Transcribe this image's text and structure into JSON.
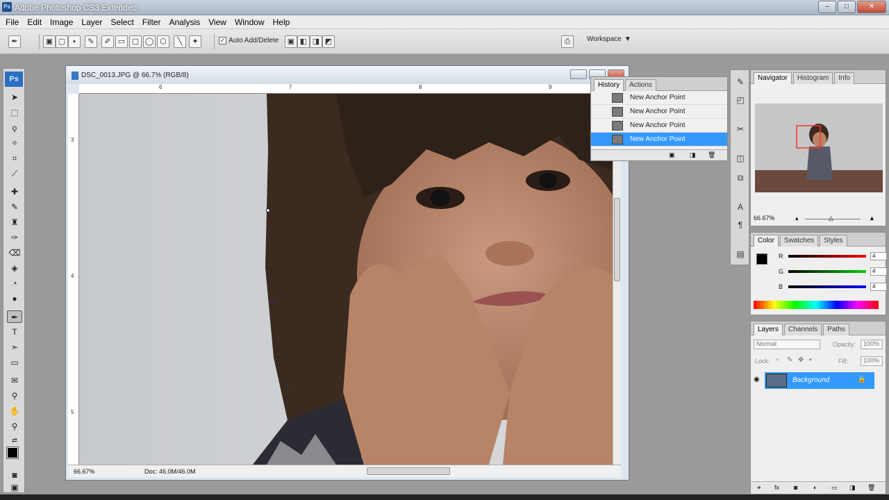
{
  "app": {
    "title": "Adobe Photoshop CS3 Extended"
  },
  "menu": [
    "File",
    "Edit",
    "Image",
    "Layer",
    "Select",
    "Filter",
    "Analysis",
    "View",
    "Window",
    "Help"
  ],
  "options_bar": {
    "auto_add_delete_label": "Auto Add/Delete",
    "auto_add_delete_checked": true,
    "workspace_label": "Workspace"
  },
  "toolbox": {
    "logo": "Ps",
    "active_tool": "pen-tool"
  },
  "document": {
    "title": "DSC_0013.JPG @ 66.7% (RGB/8)",
    "zoom": "66.67%",
    "doc_size": "Doc: 46.0M/46.0M",
    "ruler_h": [
      "6",
      "7",
      "8",
      "9"
    ],
    "ruler_v": [
      "3",
      "4",
      "5"
    ]
  },
  "history_panel": {
    "tabs": [
      "History",
      "Actions"
    ],
    "active_tab": "History",
    "items": [
      {
        "label": "New Anchor Point",
        "active": false
      },
      {
        "label": "New Anchor Point",
        "active": false
      },
      {
        "label": "New Anchor Point",
        "active": false
      },
      {
        "label": "New Anchor Point",
        "active": true
      }
    ]
  },
  "navigator_panel": {
    "tabs": [
      "Navigator",
      "Histogram",
      "Info"
    ],
    "zoom": "66.67%"
  },
  "color_panel": {
    "tabs": [
      "Color",
      "Swatches",
      "Styles"
    ],
    "channels": [
      {
        "label": "R",
        "value": "4",
        "color": "#ff0000"
      },
      {
        "label": "G",
        "value": "4",
        "color": "#00c000"
      },
      {
        "label": "B",
        "value": "4",
        "color": "#0000ff"
      }
    ],
    "foreground": "#000000",
    "background": "#ffffff"
  },
  "layers_panel": {
    "tabs": [
      "Layers",
      "Channels",
      "Paths"
    ],
    "blend_mode": "Normal",
    "opacity_label": "Opacity:",
    "opacity": "100%",
    "lock_label": "Lock:",
    "fill_label": "Fill:",
    "fill": "100%",
    "layers": [
      {
        "name": "Background",
        "selected": true,
        "locked": true
      }
    ]
  },
  "colors": {
    "selection": "#3399ff",
    "panel_bg": "#efefef",
    "workspace_bg": "#9a9a9a"
  }
}
